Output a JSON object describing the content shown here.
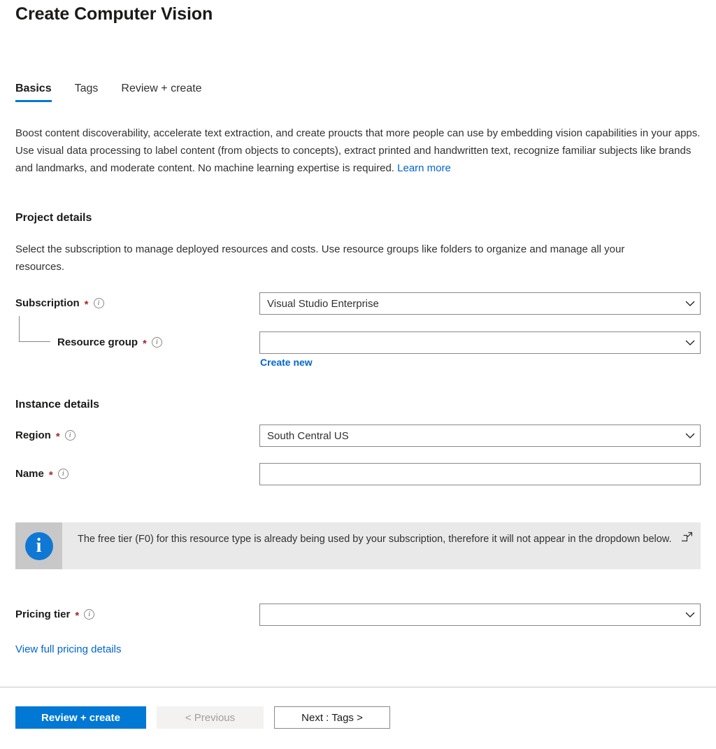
{
  "header": {
    "title": "Create Computer Vision"
  },
  "tabs": [
    {
      "label": "Basics",
      "name": "tab-basics",
      "active": true
    },
    {
      "label": "Tags",
      "name": "tab-tags",
      "active": false
    },
    {
      "label": "Review + create",
      "name": "tab-review-create",
      "active": false
    }
  ],
  "description": {
    "text": "Boost content discoverability, accelerate text extraction, and create proucts that more people can use by embedding vision capabilities in your apps. Use visual data processing to label content (from objects to concepts), extract printed and handwritten text, recognize familiar subjects like brands and landmarks, and moderate content. No machine learning expertise is required. ",
    "learn_more": "Learn more"
  },
  "project_details": {
    "heading": "Project details",
    "description": "Select the subscription to manage deployed resources and costs. Use resource groups like folders to organize and manage all your resources.",
    "subscription": {
      "label": "Subscription",
      "required_mark": "*",
      "info_glyph": "i",
      "value": "Visual Studio Enterprise"
    },
    "resource_group": {
      "label": "Resource group",
      "required_mark": "*",
      "info_glyph": "i",
      "value": "",
      "create_new_label": "Create new"
    }
  },
  "instance_details": {
    "heading": "Instance details",
    "region": {
      "label": "Region",
      "required_mark": "*",
      "info_glyph": "i",
      "value": "South Central US"
    },
    "name": {
      "label": "Name",
      "required_mark": "*",
      "info_glyph": "i",
      "value": "",
      "placeholder": ""
    }
  },
  "info_banner": {
    "icon_glyph": "i",
    "message": "The free tier (F0) for this resource type is already being used by your subscription, therefore it will not appear in the dropdown below."
  },
  "pricing": {
    "label": "Pricing tier",
    "required_mark": "*",
    "info_glyph": "i",
    "value": "",
    "full_details_link": "View full pricing details"
  },
  "footer": {
    "review_create": "Review + create",
    "previous": "< Previous",
    "next": "Next : Tags >"
  },
  "colors": {
    "accent": "#0078d4",
    "link": "#0066cc",
    "required": "#a4262c",
    "banner_bg": "#e9e9e9",
    "banner_icon_cell": "#c8c8c8",
    "border": "#8a8886"
  }
}
